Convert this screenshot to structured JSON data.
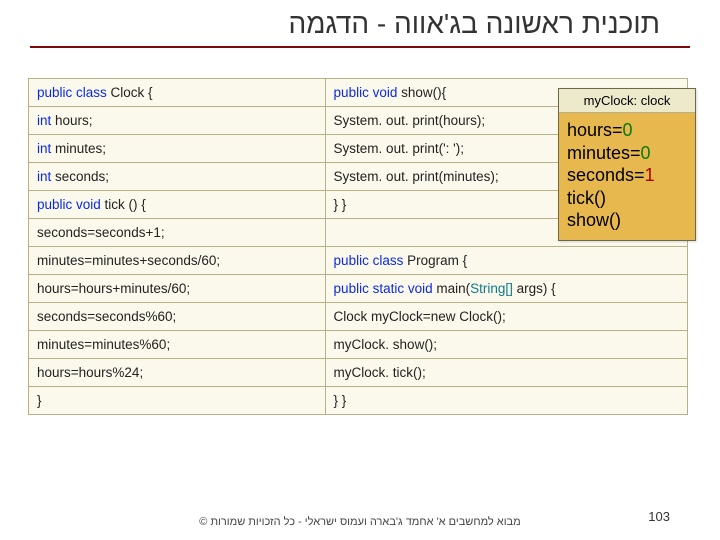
{
  "title": "תוכנית ראשונה בג'אווה - הדגמה",
  "code": {
    "left": [
      {
        "pre": "public class",
        "post": "  Clock {"
      },
      {
        "pre": "int",
        "post": " hours;"
      },
      {
        "pre": "int",
        "post": " minutes;"
      },
      {
        "pre": "int",
        "post": " seconds;"
      },
      {
        "pre": "public void",
        "post": " tick () {"
      },
      {
        "plain": " seconds=seconds+1;"
      },
      {
        "plain": " minutes=minutes+seconds/60;"
      },
      {
        "plain": " hours=hours+minutes/60;"
      },
      {
        "plain": " seconds=seconds%60;",
        "hl": true
      },
      {
        "plain": " minutes=minutes%60;",
        "hl": true
      },
      {
        "plain": " hours=hours%24;",
        "hl": true
      },
      {
        "plain": " }",
        "hl": true
      }
    ],
    "right": [
      {
        "pre": "public void",
        "post": " show(){"
      },
      {
        "plain": "System. out. print(hours);"
      },
      {
        "plain": "System. out. print(': ');"
      },
      {
        "plain": "System. out. print(minutes);"
      },
      {
        "plain": "  } }"
      },
      {
        "blank": true
      },
      {
        "pre": "public class",
        "post": "  Program {"
      },
      {
        "mainline": true
      },
      {
        "plain": " Clock  myClock=new Clock();"
      },
      {
        "plain": " myClock. show();"
      },
      {
        "plain": " myClock. tick();"
      },
      {
        "plain": " } }"
      }
    ],
    "main_parts": {
      "p1": "public static void",
      "p2": " main(",
      "p3": "String[]",
      "p4": " args",
      "p5": ") {"
    }
  },
  "overlay": {
    "header": "myClock: clock",
    "lines": [
      {
        "k": "hours=",
        "v": "0",
        "cls": "val-green"
      },
      {
        "k": "minutes=",
        "v": "0",
        "cls": "val-green"
      },
      {
        "k": "seconds=",
        "v": "1",
        "cls": "val-red"
      },
      {
        "k": "tick()",
        "v": "",
        "cls": ""
      },
      {
        "k": "show()",
        "v": "",
        "cls": ""
      }
    ]
  },
  "footer": "מבוא למחשבים א' אחמד ג'בארה ועמוס ישראלי - כל הזכויות שמורות ©",
  "page": "103"
}
